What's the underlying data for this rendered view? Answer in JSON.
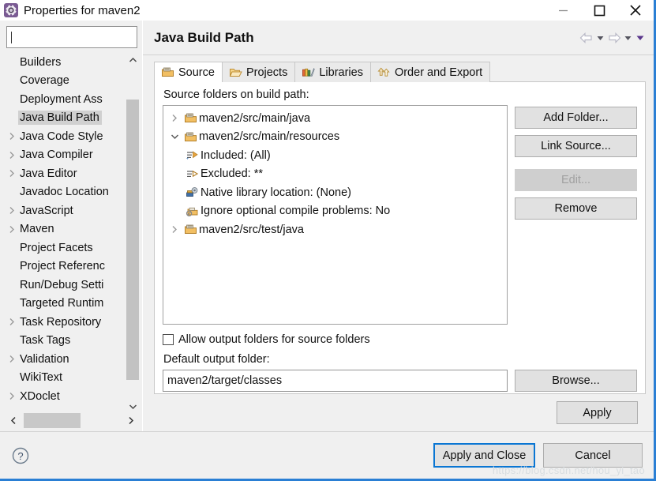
{
  "window": {
    "title": "Properties for maven2",
    "app_icon": "properties-gear-icon",
    "controls": [
      {
        "name": "minimize",
        "glyph": "minimize-icon"
      },
      {
        "name": "maximize",
        "glyph": "maximize-icon"
      },
      {
        "name": "close",
        "glyph": "close-icon"
      }
    ],
    "border_color": "#2a7fd4"
  },
  "sidebar": {
    "filter": {
      "value": "",
      "placeholder": ""
    },
    "selected": "Java Build Path",
    "items": [
      {
        "label": "Builders",
        "expandable": false
      },
      {
        "label": "Coverage",
        "expandable": false
      },
      {
        "label": "Deployment Ass",
        "expandable": false
      },
      {
        "label": "Java Build Path",
        "expandable": false,
        "selected": true
      },
      {
        "label": "Java Code Style",
        "expandable": true
      },
      {
        "label": "Java Compiler",
        "expandable": true
      },
      {
        "label": "Java Editor",
        "expandable": true
      },
      {
        "label": "Javadoc Location",
        "expandable": false
      },
      {
        "label": "JavaScript",
        "expandable": true
      },
      {
        "label": "Maven",
        "expandable": true
      },
      {
        "label": "Project Facets",
        "expandable": false
      },
      {
        "label": "Project Referenc",
        "expandable": false
      },
      {
        "label": "Run/Debug Setti",
        "expandable": false
      },
      {
        "label": "Targeted Runtim",
        "expandable": false
      },
      {
        "label": "Task Repository",
        "expandable": true
      },
      {
        "label": "Task Tags",
        "expandable": false
      },
      {
        "label": "Validation",
        "expandable": true
      },
      {
        "label": "WikiText",
        "expandable": false
      },
      {
        "label": "XDoclet",
        "expandable": true
      }
    ]
  },
  "page": {
    "title": "Java Build Path",
    "nav": [
      {
        "name": "back-arrow-icon"
      },
      {
        "name": "back-dropdown-icon"
      },
      {
        "name": "forward-arrow-icon"
      },
      {
        "name": "forward-dropdown-icon"
      },
      {
        "name": "menu-dropdown-icon"
      }
    ],
    "tabs": [
      {
        "label": "Source",
        "icon": "package-folder-icon",
        "active": true
      },
      {
        "label": "Projects",
        "icon": "open-folder-icon",
        "active": false
      },
      {
        "label": "Libraries",
        "icon": "books-icon",
        "active": false
      },
      {
        "label": "Order and Export",
        "icon": "order-arrows-icon",
        "active": false
      }
    ],
    "section_label": "Source folders on build path:",
    "tree": [
      {
        "label": "maven2/src/main/java",
        "icon": "source-folder-icon",
        "state": "collapsed",
        "level": 0
      },
      {
        "label": "maven2/src/main/resources",
        "icon": "source-folder-icon",
        "state": "expanded",
        "level": 0
      },
      {
        "label": "Included: (All)",
        "icon": "included-filter-icon",
        "state": "leaf",
        "level": 1
      },
      {
        "label": "Excluded: **",
        "icon": "excluded-filter-icon",
        "state": "leaf",
        "level": 1
      },
      {
        "label": "Native library location: (None)",
        "icon": "native-library-icon",
        "state": "leaf",
        "level": 1
      },
      {
        "label": "Ignore optional compile problems: No",
        "icon": "ignore-problems-icon",
        "state": "leaf",
        "level": 1
      },
      {
        "label": "maven2/src/test/java",
        "icon": "source-folder-icon",
        "state": "collapsed",
        "level": 0
      }
    ],
    "buttons": [
      {
        "label": "Add Folder...",
        "enabled": true
      },
      {
        "label": "Link Source...",
        "enabled": true
      },
      {
        "label": "Edit...",
        "enabled": false
      },
      {
        "label": "Remove",
        "enabled": true
      }
    ],
    "allow_output_checkbox": {
      "label": "Allow output folders for source folders",
      "checked": false
    },
    "default_output_label": "Default output folder:",
    "default_output_value": "maven2/target/classes",
    "browse_label": "Browse...",
    "apply_label": "Apply"
  },
  "footer": {
    "help_icon": "help-question-icon",
    "primary_button": "Apply and Close",
    "cancel_button": "Cancel",
    "watermark": "https://blog.csdn.net/hou_yi_tao",
    "focus_color": "#0a76d3"
  }
}
